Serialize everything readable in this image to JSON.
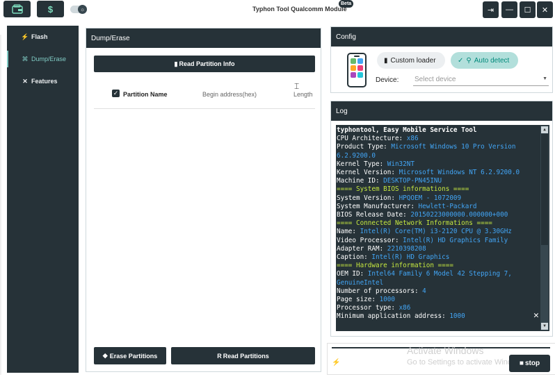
{
  "app": {
    "title": "Typhon Tool Qualcomm Module",
    "badge": "Beta"
  },
  "titlebar": {
    "dollar_label": "$",
    "window_buttons": {
      "logout": "⇥",
      "minimize": "—",
      "maximize": "☐",
      "close": "✕"
    }
  },
  "sidebar": {
    "items": [
      {
        "label": "Flash",
        "icon": "⚡",
        "active": false
      },
      {
        "label": "Dump/Erase",
        "icon": "⌘",
        "active": true
      },
      {
        "label": "Features",
        "icon": "✕",
        "active": false
      }
    ]
  },
  "dump": {
    "title": "Dump/Erase",
    "read_info_label": "Read Partition Info",
    "columns": {
      "name": "Partition Name",
      "begin": "Begin address(hex)",
      "length": "Length"
    },
    "select_all_checked": true,
    "erase_label": "Erase Partitions",
    "read_label": "Read Partitions"
  },
  "config": {
    "title": "Config",
    "custom_loader_label": "Custom loader",
    "auto_detect_label": "Auto detect",
    "device_label": "Device:",
    "device_placeholder": "Select device"
  },
  "log": {
    "title": "Log",
    "lines": [
      {
        "key": "typhontool, Easy Mobile Service Tool",
        "value": "",
        "type": "title"
      },
      {
        "key": "CPU Architecture: ",
        "value": "x86",
        "type": "kv"
      },
      {
        "key": "Product Type: ",
        "value": "Microsoft Windows 10 Pro Version 6.2.9200.0",
        "type": "kv"
      },
      {
        "key": "Kernel Type: ",
        "value": "Win32NT",
        "type": "kv"
      },
      {
        "key": "Kernel Version: ",
        "value": "Microsoft Windows NT 6.2.9200.0",
        "type": "kv"
      },
      {
        "key": "Machine ID: ",
        "value": "DESKTOP-PN45INU",
        "type": "kv"
      },
      {
        "key": "==== System BIOS informations ====",
        "value": "",
        "type": "header"
      },
      {
        "key": "System Version: ",
        "value": "HPQOEM - 1072009",
        "type": "kv"
      },
      {
        "key": "System Manufacturer: ",
        "value": "Hewlett-Packard",
        "type": "kv"
      },
      {
        "key": "BIOS Release Date: ",
        "value": "20150223000000.000000+000",
        "type": "kv"
      },
      {
        "key": "==== Connected Network Informations ====",
        "value": "",
        "type": "header"
      },
      {
        "key": "Name: ",
        "value": "Intel(R) Core(TM) i3-2120 CPU @ 3.30GHz",
        "type": "kv"
      },
      {
        "key": "Video Processor: ",
        "value": "Intel(R) HD Graphics Family",
        "type": "kv"
      },
      {
        "key": "Adapter RAM: ",
        "value": "2210398208",
        "type": "kv"
      },
      {
        "key": "Caption: ",
        "value": "Intel(R) HD Graphics",
        "type": "kv"
      },
      {
        "key": "==== Hardware information ====",
        "value": "",
        "type": "header"
      },
      {
        "key": "OEM ID: ",
        "value": "Intel64 Family 6 Model 42 Stepping 7, GenuineIntel",
        "type": "kv"
      },
      {
        "key": "Number of processors: ",
        "value": "4",
        "type": "kv"
      },
      {
        "key": "Page size: ",
        "value": "1000",
        "type": "kv"
      },
      {
        "key": "Processor type: ",
        "value": "x86",
        "type": "kv"
      },
      {
        "key": "Minimum application address: ",
        "value": "1000",
        "type": "kv"
      }
    ]
  },
  "bottom": {
    "watermark_title": "Activate Windows",
    "watermark_sub": "Go to Settings to activate Windows.",
    "stop_label": "stop"
  },
  "colors": {
    "dark": "#263238",
    "accent": "#80cbc4",
    "log_value": "#42a5f5",
    "log_header": "#c6e83f",
    "auto_detect_bg": "#b2dfdb"
  }
}
